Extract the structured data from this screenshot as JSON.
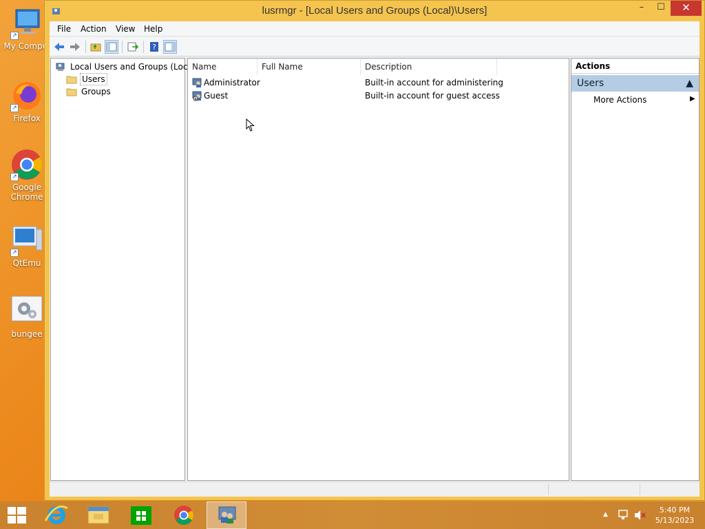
{
  "desktop": {
    "icons": [
      {
        "label": "My Compui",
        "name": "my-computer"
      },
      {
        "label": "Firefox",
        "name": "firefox"
      },
      {
        "label": "Google Chrome",
        "name": "google-chrome"
      },
      {
        "label": "QtEmu",
        "name": "qtemu"
      },
      {
        "label": "bungee",
        "name": "bungee"
      }
    ]
  },
  "window": {
    "title": "lusrmgr - [Local Users and Groups (Local)\\Users]",
    "controls": {
      "minimize": "–",
      "maximize": "☐",
      "close": "✕"
    }
  },
  "menu": {
    "file": "File",
    "action": "Action",
    "view": "View",
    "help": "Help"
  },
  "toolbar": {
    "icons": [
      "back-icon",
      "forward-icon",
      "up-folder-icon",
      "show-hide-tree-icon",
      "export-list-icon",
      "help-icon",
      "show-hide-action-pane-icon"
    ]
  },
  "tree": {
    "root": "Local Users and Groups (Local)",
    "children": [
      "Users",
      "Groups"
    ],
    "selected": "Users"
  },
  "list": {
    "columns": [
      "Name",
      "Full Name",
      "Description"
    ],
    "rows": [
      {
        "name": "Administrator",
        "full_name": "",
        "description": "Built-in account for administering..."
      },
      {
        "name": "Guest",
        "full_name": "",
        "description": "Built-in account for guest access t..."
      }
    ]
  },
  "actions": {
    "header": "Actions",
    "section": "Users",
    "items": [
      "More Actions"
    ]
  },
  "taskbar": {
    "time": "5:40 PM",
    "date": "5/13/2023",
    "apps": [
      "start",
      "internet-explorer",
      "file-explorer",
      "store",
      "chrome",
      "lusrmgr"
    ]
  },
  "colors": {
    "titlebar": "#f4c44f",
    "close": "#c7372f",
    "actions_section": "#b4cde5",
    "desktop": "#ec8a1e"
  }
}
